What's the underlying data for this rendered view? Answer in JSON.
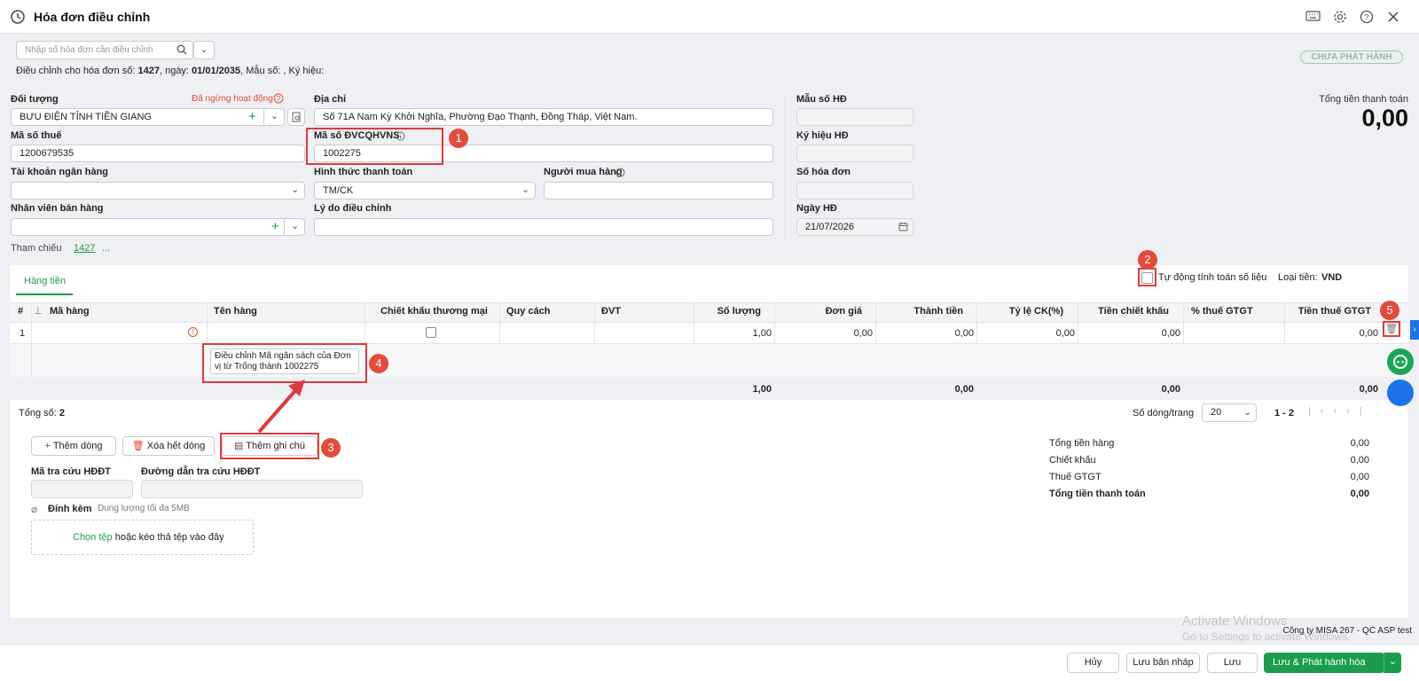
{
  "header": {
    "title": "Hóa đơn điều chỉnh"
  },
  "search": {
    "placeholder": "Nhập số hóa đơn cần điều chỉnh"
  },
  "adjust_info": {
    "prefix": "Điều chỉnh cho hóa đơn số:",
    "number": "1427",
    "date_label": ", ngày:",
    "date": "01/01/2035",
    "rest": ", Mẫu số: , Ký hiệu:"
  },
  "status_badge": "CHƯA PHÁT HÀNH",
  "form": {
    "doi_tuong_label": "Đối tượng",
    "stopped_label": "Đã ngừng hoạt động",
    "doi_tuong_value": "BƯU ĐIỆN TỈNH TIỀN GIANG",
    "dia_chi_label": "Địa chỉ",
    "dia_chi_value": "Số 71A Nam Kỳ Khởi Nghĩa, Phường Đạo Thạnh, Đồng Tháp, Việt Nam.",
    "mst_label": "Mã số thuế",
    "mst_value": "1200679535",
    "ma_dvcq_label": "Mã số ĐVCQHVNS",
    "ma_dvcq_value": "1002275",
    "tk_label": "Tài khoản ngân hàng",
    "httt_label": "Hình thức thanh toán",
    "httt_value": "TM/CK",
    "nguoi_mua_label": "Người mua hàng",
    "nv_label": "Nhân viên bán hàng",
    "ly_do_label": "Lý do điều chỉnh",
    "tham_chieu_label": "Tham chiếu",
    "tham_chieu_value": "1427",
    "tham_chieu_more": "...",
    "mau_so_label": "Mẫu số HĐ",
    "ky_hieu_label": "Ký hiệu HĐ",
    "so_hd_label": "Số hóa đơn",
    "ngay_hd_label": "Ngày HĐ",
    "ngay_hd_value": "21/07/2026"
  },
  "total_top": {
    "label": "Tổng tiền thanh toán",
    "value": "0,00"
  },
  "tabs": {
    "hang_tien": "Hàng tiền"
  },
  "auto_calc": {
    "label": "Tự động tính toán số liệu"
  },
  "currency": {
    "label": "Loại tiền:",
    "value": "VND"
  },
  "table": {
    "headers": [
      "#",
      "Mã hàng",
      "Tên hàng",
      "Chiết khấu thương mại",
      "Quy cách",
      "ĐVT",
      "Số lượng",
      "Đơn giá",
      "Thành tiền",
      "Tỷ lệ CK(%)",
      "Tiền chiết khấu",
      "% thuế GTGT",
      "Tiền thuế GTGT"
    ],
    "row1": {
      "idx": "1",
      "so_luong": "1,00",
      "don_gia": "0,00",
      "thanh_tien": "0,00",
      "ty_le_ck": "0,00",
      "tien_ck": "0,00",
      "tien_thue": "0,00"
    },
    "note_text": "Điều chỉnh Mã ngân sách của Đơn vị từ Trống thành 1002275",
    "totals": {
      "so_luong": "1,00",
      "thanh_tien": "0,00",
      "tien_ck": "0,00",
      "tien_thue": "0,00"
    }
  },
  "pager": {
    "total_label": "Tổng số:",
    "total_value": "2",
    "rows_label": "Số dòng/trang",
    "rows_value": "20",
    "range": "1 - 2"
  },
  "actions": {
    "add_row": "Thêm dòng",
    "delete_all": "Xóa hết dòng",
    "add_note": "Thêm ghi chú"
  },
  "lookup": {
    "code_label": "Mã tra cứu HĐĐT",
    "link_label": "Đường dẫn tra cứu HĐĐT"
  },
  "attach": {
    "label": "Đính kèm",
    "hint": "Dung lượng tối đa 5MB",
    "choose": "Chọn tệp",
    "drop": "hoặc kéo thả tệp vào đây"
  },
  "summary": [
    {
      "label": "Tổng tiền hàng",
      "value": "0,00"
    },
    {
      "label": "Chiết khấu",
      "value": "0,00"
    },
    {
      "label": "Thuế GTGT",
      "value": "0,00"
    },
    {
      "label": "Tổng tiền thanh toán",
      "value": "0,00"
    }
  ],
  "annotations": [
    "1",
    "2",
    "3",
    "4",
    "5"
  ],
  "watermark": {
    "line1": "Activate Windows",
    "line2": "Go to Settings to activate Windows."
  },
  "company": "Công ty MISA 267 - QC ASP test",
  "footer": {
    "cancel": "Hủy",
    "save_draft": "Lưu bản nháp",
    "save": "Lưu",
    "save_issue": "Lưu & Phát hành hóa đơn"
  },
  "colors": {
    "accent": "#1a9e4b",
    "link": "#1a9e4b",
    "warning": "#e34b3b",
    "annotation": "#e03a3a"
  },
  "icons": [
    "history-icon",
    "search-icon",
    "chevron-down-icon",
    "plus-icon",
    "book-lookup-icon",
    "info-icon",
    "calendar-icon",
    "keyboard-icon",
    "gear-icon",
    "help-icon",
    "close-icon",
    "trash-icon",
    "attachment-icon",
    "note-icon",
    "chat-icon"
  ]
}
